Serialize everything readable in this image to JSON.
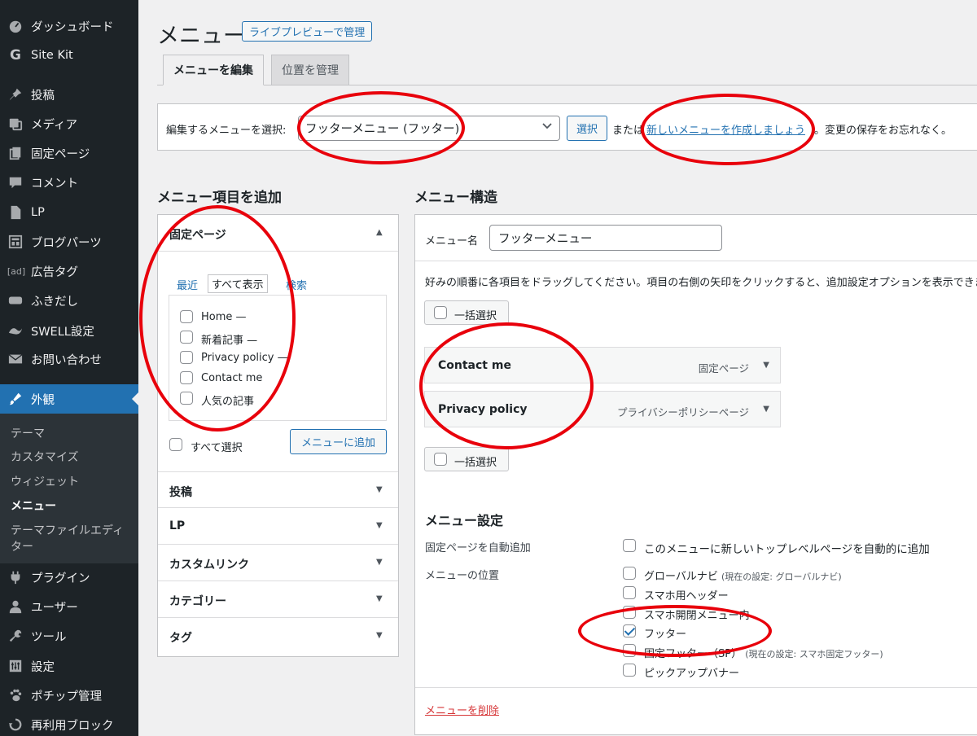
{
  "sidebar": {
    "items": [
      {
        "label": "ダッシュボード",
        "icon": "dashboard-icon"
      },
      {
        "label": "Site Kit",
        "icon": "sitekit-g-icon"
      },
      {
        "label": "投稿",
        "icon": "pin-icon"
      },
      {
        "label": "メディア",
        "icon": "media-icon"
      },
      {
        "label": "固定ページ",
        "icon": "pages-icon"
      },
      {
        "label": "コメント",
        "icon": "comment-icon"
      },
      {
        "label": "LP",
        "icon": "document-icon"
      },
      {
        "label": "ブログパーツ",
        "icon": "layout-icon"
      },
      {
        "label": "広告タグ",
        "icon": "ad-icon",
        "badge": "[ad]"
      },
      {
        "label": "ふきだし",
        "icon": "balloon-icon"
      },
      {
        "label": "SWELL設定",
        "icon": "swell-icon"
      },
      {
        "label": "お問い合わせ",
        "icon": "mail-icon"
      },
      {
        "label": "外観",
        "icon": "brush-icon"
      },
      {
        "label": "プラグイン",
        "icon": "plugin-icon"
      },
      {
        "label": "ユーザー",
        "icon": "user-icon"
      },
      {
        "label": "ツール",
        "icon": "wrench-icon"
      },
      {
        "label": "設定",
        "icon": "settings-icon"
      },
      {
        "label": "ポチップ管理",
        "icon": "paw-icon"
      },
      {
        "label": "再利用ブロック",
        "icon": "reuse-icon"
      }
    ],
    "submenu": [
      {
        "label": "テーマ"
      },
      {
        "label": "カスタマイズ"
      },
      {
        "label": "ウィジェット"
      },
      {
        "label": "メニュー"
      },
      {
        "label": "テーマファイルエディ"
      },
      {
        "label": "ター"
      }
    ]
  },
  "header": {
    "title": "メニュー",
    "live_preview": "ライブプレビューで管理",
    "tabs": [
      {
        "label": "メニューを編集"
      },
      {
        "label": "位置を管理"
      }
    ]
  },
  "select_bar": {
    "label": "編集するメニューを選択:",
    "selected": "フッターメニュー (フッター)",
    "button": "選択",
    "or_text": "または",
    "create_link": "新しいメニューを作成しましょう",
    "remind": "。変更の保存をお忘れなく。"
  },
  "add_items": {
    "title": "メニュー項目を追加",
    "pages_section": {
      "title": "固定ページ",
      "tabs": [
        "最近",
        "すべて表示",
        "検索"
      ],
      "pages": [
        "Home —",
        "新着記事 —",
        "Privacy policy —",
        "Contact me",
        "人気の記事"
      ],
      "select_all": "すべて選択",
      "add_button": "メニューに追加"
    },
    "sections": [
      "投稿",
      "LP",
      "カスタムリンク",
      "カテゴリー",
      "タグ"
    ]
  },
  "structure": {
    "title": "メニュー構造",
    "name_label": "メニュー名",
    "name_value": "フッターメニュー",
    "instruction": "好みの順番に各項目をドラッグしてください。項目の右側の矢印をクリックすると、追加設定オプションを表示できます。",
    "bulk_select": "一括選択",
    "items": [
      {
        "title": "Contact me",
        "type": "固定ページ"
      },
      {
        "title": "Privacy policy",
        "type": "プライバシーポリシーページ"
      }
    ],
    "settings": {
      "title": "メニュー設定",
      "auto_add_label": "固定ページを自動追加",
      "auto_add_option": "このメニューに新しいトップレベルページを自動的に追加",
      "location_label": "メニューの位置",
      "locations": [
        {
          "label": "グローバルナビ",
          "note": "(現在の設定: グローバルナビ)",
          "checked": false
        },
        {
          "label": "スマホ用ヘッダー",
          "note": "",
          "checked": false
        },
        {
          "label": "スマホ開閉メニュー内",
          "note": "",
          "checked": false
        },
        {
          "label": "フッター",
          "note": "",
          "checked": true
        },
        {
          "label": "固定フッター（SP）",
          "note": "(現在の設定: スマホ固定フッター)",
          "checked": false
        },
        {
          "label": "ピックアップバナー",
          "note": "",
          "checked": false
        }
      ]
    },
    "delete_link": "メニューを削除"
  },
  "colors": {
    "sidebar_bg": "#1d2327",
    "accent": "#2271b1",
    "annotation": "#e8000b",
    "delete": "#d63638"
  }
}
